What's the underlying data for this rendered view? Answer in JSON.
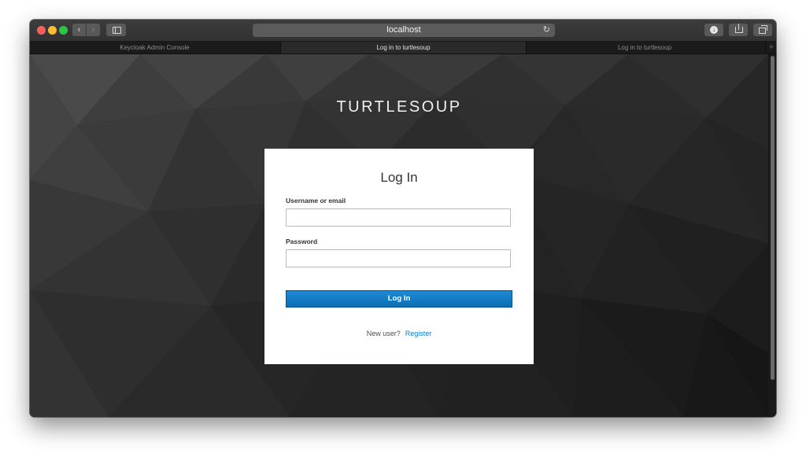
{
  "browser": {
    "address": "localhost",
    "tabs": [
      {
        "label": "Keycloak Admin Console",
        "active": false
      },
      {
        "label": "Log in to turtlesoup",
        "active": true
      },
      {
        "label": "Log in to turtlesoup",
        "active": false
      }
    ],
    "icons": {
      "back": "chevron-left-icon",
      "forward": "chevron-right-icon",
      "sidebar": "sidebar-icon",
      "reload": "reload-icon",
      "download": "download-icon",
      "share": "share-icon",
      "tabs": "tab-overview-icon",
      "new_tab": "plus-icon"
    },
    "glyphs": {
      "back": "‹",
      "forward": "›",
      "reload": "↻",
      "download": "↓",
      "new_tab": "+"
    }
  },
  "page": {
    "brand": "TURTLESOUP",
    "title": "Log In",
    "username_label": "Username or email",
    "username_value": "",
    "password_label": "Password",
    "password_value": "",
    "login_button": "Log In",
    "new_user_text": "New user?",
    "register_link": "Register"
  },
  "colors": {
    "accent": "#0b79c7",
    "button": "#0b6fb5",
    "background": "#2c2c2c",
    "card": "#ffffff"
  }
}
